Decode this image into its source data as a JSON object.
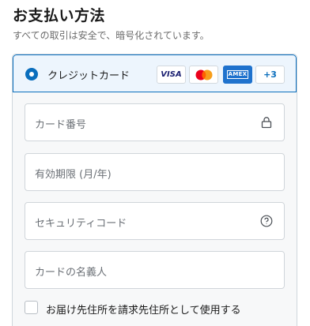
{
  "header": {
    "title": "お支払い方法",
    "subtitle": "すべての取引は安全で、暗号化されています。"
  },
  "payment_method": {
    "selected": true,
    "label": "クレジットカード",
    "brands": [
      {
        "name": "VISA",
        "icon": "visa-logo-icon",
        "color": "#1a1f71"
      },
      {
        "name": "Mastercard",
        "icon": "mastercard-logo-icon",
        "colors": [
          "#eb001b",
          "#f79e1b"
        ]
      },
      {
        "name": "AMEX",
        "icon": "amex-logo-icon",
        "color": "#1f72cd"
      }
    ],
    "more_brands_label": "+3"
  },
  "form": {
    "card_number": {
      "placeholder": "カード番号",
      "value": "",
      "icon": "lock-icon"
    },
    "expiry": {
      "placeholder": "有効期限 (月/年)",
      "value": ""
    },
    "security_code": {
      "placeholder": "セキュリティコード",
      "value": "",
      "icon": "help-circle-icon"
    },
    "cardholder_name": {
      "placeholder": "カードの名義人",
      "value": ""
    }
  },
  "billing_same_as_shipping": {
    "label": "お届け先住所を請求先住所として使用する",
    "checked": false
  },
  "colors": {
    "accent": "#0a6ebd",
    "selected_bg": "#edf5fd",
    "panel_bg": "#f7f8f9"
  }
}
